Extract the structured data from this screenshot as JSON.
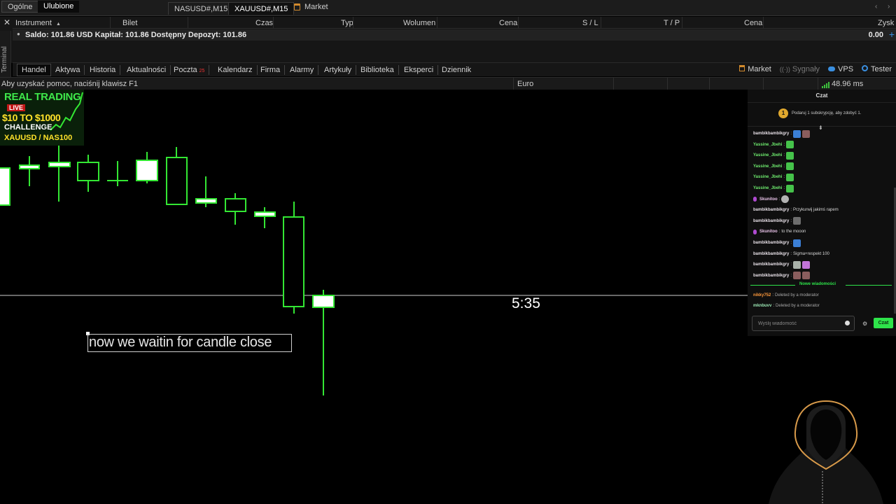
{
  "top_tabs": {
    "general": "Ogólne",
    "favorites": "Ulubione",
    "chart_tabs": [
      "NASUSD#,M15",
      "XAUUSD#,M15"
    ],
    "market": "Market"
  },
  "terminal": {
    "side_label": "Terminal",
    "columns": [
      "Instrument",
      "Bilet",
      "Czas",
      "Typ",
      "Wolumen",
      "Cena",
      "S / L",
      "T / P",
      "Cena",
      "Zysk"
    ],
    "balance_text": "Saldo: 101.86 USD  Kapitał: 101.86  Dostępny Depozyt: 101.86",
    "profit_total": "0.00",
    "tabs": [
      "Handel",
      "Aktywa",
      "Historia",
      "Aktualności",
      "Poczta",
      "Kalendarz",
      "Firma",
      "Alarmy",
      "Artykuły",
      "Biblioteka",
      "Eksperci",
      "Dziennik"
    ],
    "mail_badge": "25",
    "right_links": {
      "market": "Market",
      "signals": "Sygnały",
      "vps": "VPS",
      "tester": "Tester"
    }
  },
  "statusbar": {
    "help": "Aby uzyskać pomoc, naciśnij klawisz F1",
    "profile": "Euro",
    "ping": "48.96 ms"
  },
  "chart": {
    "countdown": "5:35",
    "note": "now we waitin for candle close"
  },
  "logo": {
    "line1": "REAL TRADING",
    "live": "LIVE",
    "line3": "$10 TO $1000",
    "line4": "CHALLENGE",
    "line5": "XAUUSD / NAS100"
  },
  "chat": {
    "title": "Czat",
    "sub_prompt": "Podaruj 1 subskrypcję, aby zdobyć 1.",
    "coin": "1",
    "messages": [
      {
        "user": "bambikbambikgry",
        "text": "",
        "emotes": [
          "e-blue",
          "e-brown"
        ],
        "style": "user-white"
      },
      {
        "user": "Yassine_Jbehi",
        "text": "",
        "emotes": [
          "e-green"
        ],
        "style": "user-green"
      },
      {
        "user": "Yassine_Jbehi",
        "text": "",
        "emotes": [
          "e-green"
        ],
        "style": "user-green"
      },
      {
        "user": "Yassine_Jbehi",
        "text": "",
        "emotes": [
          "e-green"
        ],
        "style": "user-green"
      },
      {
        "user": "Yassine_Jbehi",
        "text": "",
        "emotes": [
          "e-green"
        ],
        "style": "user-green"
      },
      {
        "user": "Yassine_Jbehi",
        "text": "",
        "emotes": [
          "e-green"
        ],
        "style": "user-green"
      },
      {
        "user": "Skunitoo",
        "text": "",
        "emotes": [
          "e-face"
        ],
        "style": "user-pink",
        "mod": true
      },
      {
        "user": "bambikbambikgry",
        "text": "Przykurwij jakimś rapem",
        "emotes": [],
        "style": "user-white"
      },
      {
        "user": "bambikbambikgry",
        "text": "",
        "emotes": [
          "e-gray"
        ],
        "style": "user-white"
      },
      {
        "user": "Skunitoo",
        "text": "to the mooon",
        "emotes": [],
        "style": "user-pink",
        "mod": true
      },
      {
        "user": "bambikbambikgry",
        "text": "",
        "emotes": [
          "e-blue"
        ],
        "style": "user-white"
      },
      {
        "user": "bambikbambikgry",
        "text": "Sigma+respekt 100",
        "emotes": [],
        "style": "user-white"
      },
      {
        "user": "bambikbambikgry",
        "text": "",
        "emotes": [
          "e-cat",
          "e-pink"
        ],
        "style": "user-white"
      },
      {
        "user": "bambikbambikgry",
        "text": "",
        "emotes": [
          "e-brown",
          "e-brown"
        ],
        "style": "user-white"
      }
    ],
    "new_messages_label": "Nowe wiadomości",
    "recent": [
      {
        "user": "nikky752",
        "text": "Deleted by a moderator",
        "style": "user-orange"
      },
      {
        "user": "mknbuvv",
        "text": "Deleted by a moderator",
        "style": "user-mint"
      }
    ],
    "input_placeholder": "Wyślij wiadomość",
    "send_label": "Czat"
  }
}
